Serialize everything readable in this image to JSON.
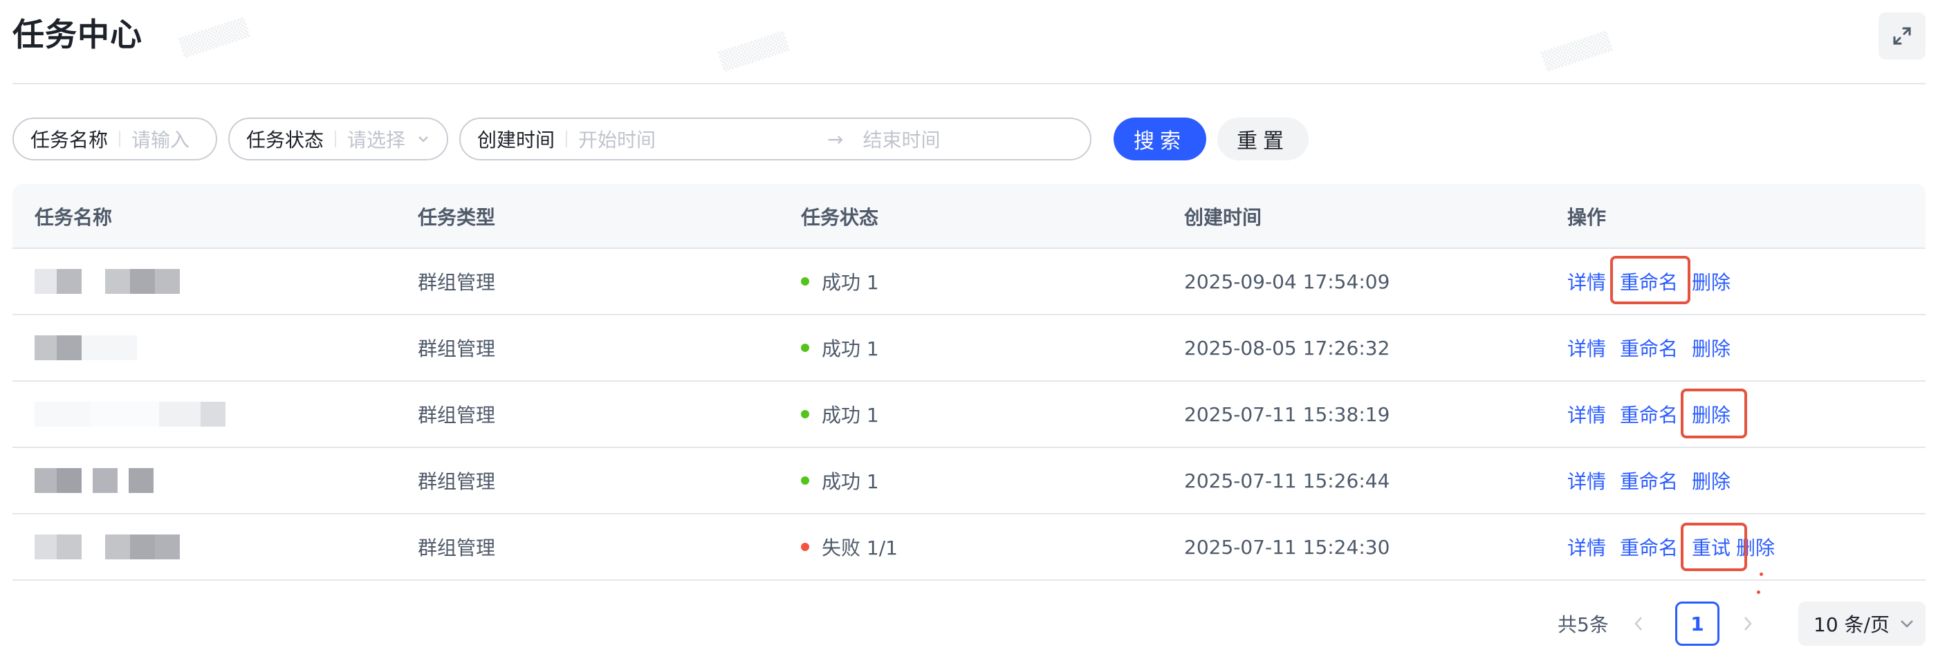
{
  "header": {
    "title": "任务中心"
  },
  "filters": {
    "name": {
      "label": "任务名称",
      "placeholder": "请输入"
    },
    "status": {
      "label": "任务状态",
      "placeholder": "请选择"
    },
    "created": {
      "label": "创建时间",
      "start_placeholder": "开始时间",
      "end_placeholder": "结束时间",
      "arrow": "→"
    },
    "search_label": "搜索",
    "reset_label": "重置"
  },
  "table": {
    "columns": [
      "任务名称",
      "任务类型",
      "任务状态",
      "创建时间",
      "操作"
    ],
    "rows": [
      {
        "type": "群组管理",
        "status": "成功 1",
        "status_color": "#52c41a",
        "created": "2025-09-04 17:54:09",
        "actions": [
          "详情",
          "重命名",
          "删除"
        ]
      },
      {
        "type": "群组管理",
        "status": "成功 1",
        "status_color": "#52c41a",
        "created": "2025-08-05 17:26:32",
        "actions": [
          "详情",
          "重命名",
          "删除"
        ]
      },
      {
        "type": "群组管理",
        "status": "成功 1",
        "status_color": "#52c41a",
        "created": "2025-07-11 15:38:19",
        "actions": [
          "详情",
          "重命名",
          "删除"
        ]
      },
      {
        "type": "群组管理",
        "status": "成功 1",
        "status_color": "#52c41a",
        "created": "2025-07-11 15:26:44",
        "actions": [
          "详情",
          "重命名",
          "删除"
        ]
      },
      {
        "type": "群组管理",
        "status": "失败 1/1",
        "status_color": "#f5533d",
        "created": "2025-07-11 15:24:30",
        "actions": [
          "详情",
          "重命名",
          "重试",
          "删除"
        ]
      }
    ]
  },
  "pagination": {
    "total": "共5条",
    "current": "1",
    "page_size": "10 条/页"
  },
  "colors": {
    "accent": "#2b5cff",
    "success": "#52c41a",
    "error": "#f5533d",
    "highlight": "#e5533f"
  },
  "icons": {
    "expand": "expand-icon",
    "prev": "chevron-left-icon",
    "next": "chevron-right-icon",
    "dropdown": "chevron-down-icon"
  }
}
